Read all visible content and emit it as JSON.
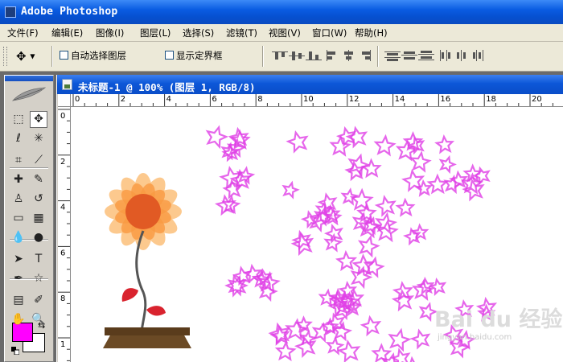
{
  "window": {
    "title": "Adobe Photoshop"
  },
  "menu": [
    {
      "label": "文件(F)",
      "name": "menu-file"
    },
    {
      "label": "编辑(E)",
      "name": "menu-edit"
    },
    {
      "label": "图像(I)",
      "name": "menu-image"
    },
    {
      "label": "图层(L)",
      "name": "menu-layer"
    },
    {
      "label": "选择(S)",
      "name": "menu-select"
    },
    {
      "label": "滤镜(T)",
      "name": "menu-filter"
    },
    {
      "label": "视图(V)",
      "name": "menu-view"
    },
    {
      "label": "窗口(W)",
      "name": "menu-window"
    },
    {
      "label": "帮助(H)",
      "name": "menu-help"
    }
  ],
  "options": {
    "auto_select_layer": "自动选择图层",
    "show_bounding_box": "显示定界框",
    "auto_select_checked": false,
    "show_bounds_checked": false
  },
  "document": {
    "title": "未标题-1 @ 100% (图层 1, RGB/8)",
    "ruler_h_labels": [
      "0",
      "2",
      "4",
      "6",
      "8",
      "10",
      "12",
      "14",
      "16",
      "18",
      "20"
    ],
    "ruler_v_labels": [
      "0",
      "2",
      "4",
      "6",
      "8",
      "1"
    ]
  },
  "colors": {
    "foreground": "#ff00ff",
    "background": "#ffffff",
    "star_stroke": "#e040e6",
    "petal_outer": "#fcbf7a",
    "petal_inner": "#f99a42",
    "flower_center": "#e15a24",
    "stem": "#555555",
    "leaf": "#d9232e",
    "pot": "#6b4a25"
  },
  "tools": [
    {
      "name": "marquee-tool-icon",
      "glyph": "⬚"
    },
    {
      "name": "move-tool-icon",
      "glyph": "✥"
    },
    {
      "name": "lasso-tool-icon",
      "glyph": "ℓ"
    },
    {
      "name": "magic-wand-tool-icon",
      "glyph": "✳"
    },
    {
      "name": "crop-tool-icon",
      "glyph": "⌗"
    },
    {
      "name": "slice-tool-icon",
      "glyph": "⟋"
    },
    {
      "name": "healing-brush-tool-icon",
      "glyph": "✚"
    },
    {
      "name": "brush-tool-icon",
      "glyph": "✎"
    },
    {
      "name": "clone-stamp-tool-icon",
      "glyph": "♙"
    },
    {
      "name": "history-brush-tool-icon",
      "glyph": "↺"
    },
    {
      "name": "eraser-tool-icon",
      "glyph": "▭"
    },
    {
      "name": "gradient-tool-icon",
      "glyph": "▦"
    },
    {
      "name": "blur-tool-icon",
      "glyph": "💧"
    },
    {
      "name": "dodge-tool-icon",
      "glyph": "●"
    },
    {
      "name": "path-selection-tool-icon",
      "glyph": "➤"
    },
    {
      "name": "type-tool-icon",
      "glyph": "T"
    },
    {
      "name": "pen-tool-icon",
      "glyph": "✒"
    },
    {
      "name": "shape-tool-icon",
      "glyph": "☆"
    },
    {
      "name": "notes-tool-icon",
      "glyph": "▤"
    },
    {
      "name": "eyedropper-tool-icon",
      "glyph": "✐"
    },
    {
      "name": "hand-tool-icon",
      "glyph": "✋"
    },
    {
      "name": "zoom-tool-icon",
      "glyph": "🔍"
    }
  ],
  "watermark": {
    "main": "Bai du 经验",
    "sub": "jingyan.baidu.com"
  }
}
